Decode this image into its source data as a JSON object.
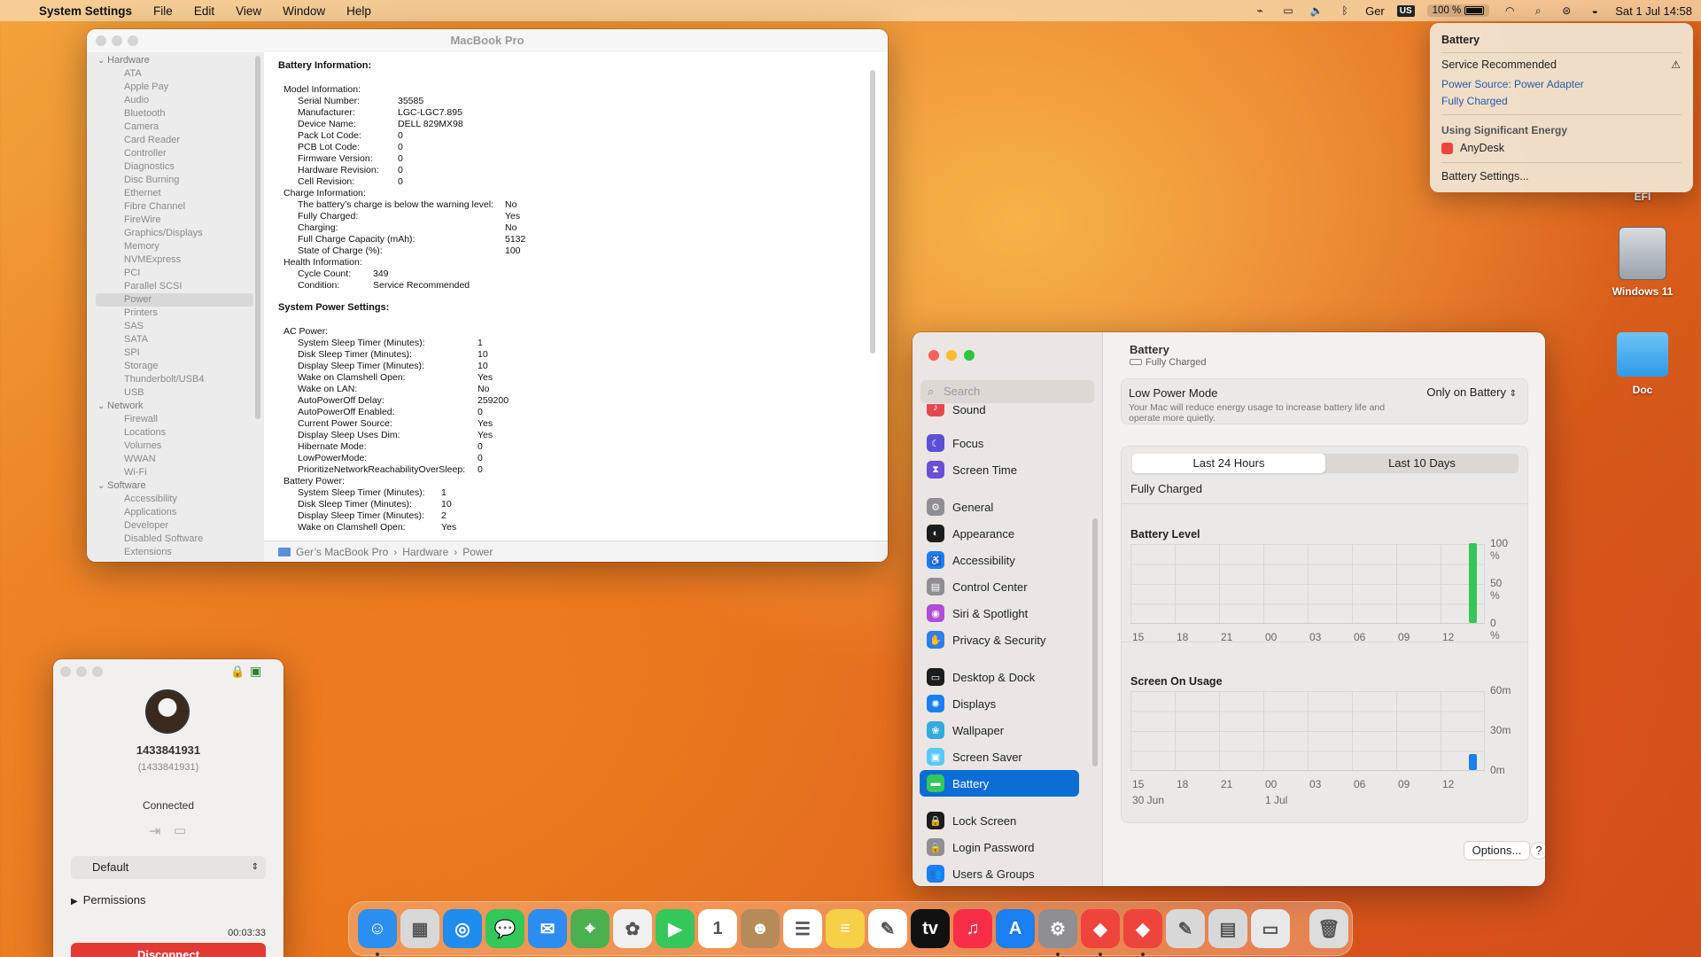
{
  "menubar": {
    "app": "System Settings",
    "items": [
      "File",
      "Edit",
      "View",
      "Window",
      "Help"
    ],
    "lang": "Ger",
    "kbd": "US",
    "battery_pct": "100 %",
    "datetime": "Sat 1 Jul  14:58"
  },
  "sysinfo": {
    "title": "MacBook Pro",
    "sidebar": [
      {
        "t": "g",
        "l": "Hardware"
      },
      {
        "t": "i",
        "l": "ATA"
      },
      {
        "t": "i",
        "l": "Apple Pay"
      },
      {
        "t": "i",
        "l": "Audio"
      },
      {
        "t": "i",
        "l": "Bluetooth"
      },
      {
        "t": "i",
        "l": "Camera"
      },
      {
        "t": "i",
        "l": "Card Reader"
      },
      {
        "t": "i",
        "l": "Controller"
      },
      {
        "t": "i",
        "l": "Diagnostics"
      },
      {
        "t": "i",
        "l": "Disc Burning"
      },
      {
        "t": "i",
        "l": "Ethernet"
      },
      {
        "t": "i",
        "l": "Fibre Channel"
      },
      {
        "t": "i",
        "l": "FireWire"
      },
      {
        "t": "i",
        "l": "Graphics/Displays"
      },
      {
        "t": "i",
        "l": "Memory"
      },
      {
        "t": "i",
        "l": "NVMExpress"
      },
      {
        "t": "i",
        "l": "PCI"
      },
      {
        "t": "i",
        "l": "Parallel SCSI"
      },
      {
        "t": "s",
        "l": "Power"
      },
      {
        "t": "i",
        "l": "Printers"
      },
      {
        "t": "i",
        "l": "SAS"
      },
      {
        "t": "i",
        "l": "SATA"
      },
      {
        "t": "i",
        "l": "SPI"
      },
      {
        "t": "i",
        "l": "Storage"
      },
      {
        "t": "i",
        "l": "Thunderbolt/USB4"
      },
      {
        "t": "i",
        "l": "USB"
      },
      {
        "t": "g",
        "l": "Network"
      },
      {
        "t": "i",
        "l": "Firewall"
      },
      {
        "t": "i",
        "l": "Locations"
      },
      {
        "t": "i",
        "l": "Volumes"
      },
      {
        "t": "i",
        "l": "WWAN"
      },
      {
        "t": "i",
        "l": "Wi-Fi"
      },
      {
        "t": "g",
        "l": "Software"
      },
      {
        "t": "i",
        "l": "Accessibility"
      },
      {
        "t": "i",
        "l": "Applications"
      },
      {
        "t": "i",
        "l": "Developer"
      },
      {
        "t": "i",
        "l": "Disabled Software"
      },
      {
        "t": "i",
        "l": "Extensions"
      }
    ],
    "sections": [
      {
        "heading": "Battery Information:",
        "rows": [
          {
            "i": 0,
            "k": "Model Information:",
            "v": ""
          },
          {
            "i": 1,
            "k": "Serial Number:",
            "v": "35585",
            "c": "a"
          },
          {
            "i": 1,
            "k": "Manufacturer:",
            "v": "LGC-LGC7.895",
            "c": "a"
          },
          {
            "i": 1,
            "k": "Device Name:",
            "v": "DELL 829MX98",
            "c": "a"
          },
          {
            "i": 1,
            "k": "Pack Lot Code:",
            "v": "0",
            "c": "a"
          },
          {
            "i": 1,
            "k": "PCB Lot Code:",
            "v": "0",
            "c": "a"
          },
          {
            "i": 1,
            "k": "Firmware Version:",
            "v": "0",
            "c": "a"
          },
          {
            "i": 1,
            "k": "Hardware Revision:",
            "v": "0",
            "c": "a"
          },
          {
            "i": 1,
            "k": "Cell Revision:",
            "v": "0",
            "c": "a"
          },
          {
            "i": 0,
            "k": "Charge Information:",
            "v": ""
          },
          {
            "i": 1,
            "k": "The battery’s charge is below the warning level:",
            "v": "No",
            "c": "b"
          },
          {
            "i": 1,
            "k": "Fully Charged:",
            "v": "Yes",
            "c": "b"
          },
          {
            "i": 1,
            "k": "Charging:",
            "v": "No",
            "c": "b"
          },
          {
            "i": 1,
            "k": "Full Charge Capacity (mAh):",
            "v": "5132",
            "c": "b"
          },
          {
            "i": 1,
            "k": "State of Charge (%):",
            "v": "100",
            "c": "b"
          },
          {
            "i": 0,
            "k": "Health Information:",
            "v": ""
          },
          {
            "i": 1,
            "k": "Cycle Count:",
            "v": "349",
            "c": "c"
          },
          {
            "i": 1,
            "k": "Condition:",
            "v": "Service Recommended",
            "c": "c"
          }
        ]
      },
      {
        "heading": "System Power Settings:",
        "rows": [
          {
            "i": 0,
            "k": "AC Power:",
            "v": ""
          },
          {
            "i": 1,
            "k": "System Sleep Timer (Minutes):",
            "v": "1",
            "c": "d"
          },
          {
            "i": 1,
            "k": "Disk Sleep Timer (Minutes):",
            "v": "10",
            "c": "d"
          },
          {
            "i": 1,
            "k": "Display Sleep Timer (Minutes):",
            "v": "10",
            "c": "d"
          },
          {
            "i": 1,
            "k": "Wake on Clamshell Open:",
            "v": "Yes",
            "c": "d"
          },
          {
            "i": 1,
            "k": "Wake on LAN:",
            "v": "No",
            "c": "d"
          },
          {
            "i": 1,
            "k": "AutoPowerOff Delay:",
            "v": "259200",
            "c": "d"
          },
          {
            "i": 1,
            "k": "AutoPowerOff Enabled:",
            "v": "0",
            "c": "d"
          },
          {
            "i": 1,
            "k": "Current Power Source:",
            "v": "Yes",
            "c": "d"
          },
          {
            "i": 1,
            "k": "Display Sleep Uses Dim:",
            "v": "Yes",
            "c": "d"
          },
          {
            "i": 1,
            "k": "Hibernate Mode:",
            "v": "0",
            "c": "d"
          },
          {
            "i": 1,
            "k": "LowPowerMode:",
            "v": "0",
            "c": "d"
          },
          {
            "i": 1,
            "k": "PrioritizeNetworkReachabilityOverSleep:",
            "v": "0",
            "c": "d"
          },
          {
            "i": 0,
            "k": "Battery Power:",
            "v": ""
          },
          {
            "i": 1,
            "k": "System Sleep Timer (Minutes):",
            "v": "1",
            "c": "e"
          },
          {
            "i": 1,
            "k": "Disk Sleep Timer (Minutes):",
            "v": "10",
            "c": "e"
          },
          {
            "i": 1,
            "k": "Display Sleep Timer (Minutes):",
            "v": "2",
            "c": "e"
          },
          {
            "i": 1,
            "k": "Wake on Clamshell Open:",
            "v": "Yes",
            "c": "e"
          }
        ]
      }
    ],
    "path": [
      "Ger’s MacBook Pro",
      "Hardware",
      "Power"
    ]
  },
  "anydesk": {
    "id": "1433841931",
    "id_paren": "(1433841931)",
    "status": "Connected",
    "profile": "Default",
    "permissions": "Permissions",
    "timer": "00:03:33",
    "disconnect": "Disconnect"
  },
  "battery_popup": {
    "title": "Battery",
    "service": "Service Recommended",
    "source": "Power Source: Power Adapter",
    "charged": "Fully Charged",
    "energy_heading": "Using Significant Energy",
    "app": "AnyDesk",
    "settings_link": "Battery Settings..."
  },
  "desktop": {
    "icons": [
      "EFI",
      "Windows 11",
      "Doc"
    ]
  },
  "settings": {
    "search_placeholder": "Search",
    "sidebar": [
      {
        "label": "Sound",
        "color": "#e5484d",
        "glyph": "♪"
      },
      {
        "label": "Focus",
        "color": "#5b4fd6",
        "glyph": "☾"
      },
      {
        "label": "Screen Time",
        "color": "#6a4fd6",
        "glyph": "⧗"
      },
      {
        "label": "General",
        "color": "#8e8e93",
        "glyph": "⚙"
      },
      {
        "label": "Appearance",
        "color": "#1c1c1e",
        "glyph": "◐"
      },
      {
        "label": "Accessibility",
        "color": "#1a7ff0",
        "glyph": "♿"
      },
      {
        "label": "Control Center",
        "color": "#8e8e93",
        "glyph": "▤"
      },
      {
        "label": "Siri & Spotlight",
        "color": "#b04cd6",
        "glyph": "◉"
      },
      {
        "label": "Privacy & Security",
        "color": "#2f7df0",
        "glyph": "✋"
      },
      {
        "label": "Desktop & Dock",
        "color": "#1c1c1e",
        "glyph": "▭"
      },
      {
        "label": "Displays",
        "color": "#1a7ff0",
        "glyph": "✺"
      },
      {
        "label": "Wallpaper",
        "color": "#34aadc",
        "glyph": "❀"
      },
      {
        "label": "Screen Saver",
        "color": "#5ac8fa",
        "glyph": "▣"
      },
      {
        "label": "Battery",
        "color": "#34c759",
        "glyph": "▬"
      },
      {
        "label": "Lock Screen",
        "color": "#1c1c1e",
        "glyph": "🔒"
      },
      {
        "label": "Login Password",
        "color": "#8e8e93",
        "glyph": "🔒"
      },
      {
        "label": "Users & Groups",
        "color": "#1a7ff0",
        "glyph": "👥"
      }
    ],
    "selected": "Battery",
    "header_title": "Battery",
    "header_sub": "Fully Charged",
    "low_power_label": "Low Power Mode",
    "low_power_desc": "Your Mac will reduce energy usage to increase battery life and operate more quietly.",
    "low_power_value": "Only on Battery",
    "tabs": [
      "Last 24 Hours",
      "Last 10 Days"
    ],
    "tab_selected": "Last 24 Hours",
    "status": "Fully Charged",
    "options_btn": "Options...",
    "help_btn": "?"
  },
  "chart_data": [
    {
      "type": "bar",
      "title": "Battery Level",
      "x": [
        "15",
        "18",
        "21",
        "00",
        "03",
        "06",
        "09",
        "12"
      ],
      "y_ticks": [
        "100 %",
        "50 %",
        "0 %"
      ],
      "ylim": [
        0,
        100
      ],
      "values_last_bar": 100,
      "series_color": "#34c759"
    },
    {
      "type": "bar",
      "title": "Screen On Usage",
      "x": [
        "15",
        "18",
        "21",
        "00",
        "03",
        "06",
        "09",
        "12"
      ],
      "x_sub": [
        "30 Jun",
        "1 Jul"
      ],
      "y_ticks": [
        "60m",
        "30m",
        "0m"
      ],
      "ylim": [
        0,
        60
      ],
      "values_last_bar": 12,
      "series_color": "#1a7ff0"
    }
  ],
  "dock": {
    "apps": [
      {
        "name": "Finder",
        "color": "#2a8ff0",
        "glyph": "☺"
      },
      {
        "name": "Launchpad",
        "color": "#d8d8d8",
        "glyph": "▦"
      },
      {
        "name": "Safari",
        "color": "#1f8cf0",
        "glyph": "◎"
      },
      {
        "name": "Messages",
        "color": "#34c759",
        "glyph": "💬"
      },
      {
        "name": "Mail",
        "color": "#2d8cf0",
        "glyph": "✉"
      },
      {
        "name": "Maps",
        "color": "#4cb050",
        "glyph": "⌖"
      },
      {
        "name": "Photos",
        "color": "#f0f0f0",
        "glyph": "✿"
      },
      {
        "name": "FaceTime",
        "color": "#34c759",
        "glyph": "▶"
      },
      {
        "name": "Calendar",
        "color": "#ffffff",
        "glyph": "1"
      },
      {
        "name": "Contacts",
        "color": "#b58b5a",
        "glyph": "☻"
      },
      {
        "name": "Reminders",
        "color": "#ffffff",
        "glyph": "☰"
      },
      {
        "name": "Notes",
        "color": "#f6d046",
        "glyph": "≡"
      },
      {
        "name": "Freeform",
        "color": "#ffffff",
        "glyph": "✎"
      },
      {
        "name": "TV",
        "color": "#111111",
        "glyph": "tv"
      },
      {
        "name": "Music",
        "color": "#fa2d48",
        "glyph": "♫"
      },
      {
        "name": "App Store",
        "color": "#1a7ff0",
        "glyph": "A"
      },
      {
        "name": "System Settings",
        "color": "#8e8e93",
        "glyph": "⚙"
      },
      {
        "name": "AnyDesk",
        "color": "#ef443b",
        "glyph": "◆"
      },
      {
        "name": "AnyDesk 2",
        "color": "#ef443b",
        "glyph": "◆"
      },
      {
        "name": "Script Editor",
        "color": "#d8d8d8",
        "glyph": "✎"
      },
      {
        "name": "Automator",
        "color": "#d8d8d8",
        "glyph": "▤"
      },
      {
        "name": "Preview",
        "color": "#e8e8e8",
        "glyph": "▭"
      },
      {
        "name": "Trash",
        "color": "#dcdcdc",
        "glyph": "🗑"
      }
    ]
  }
}
